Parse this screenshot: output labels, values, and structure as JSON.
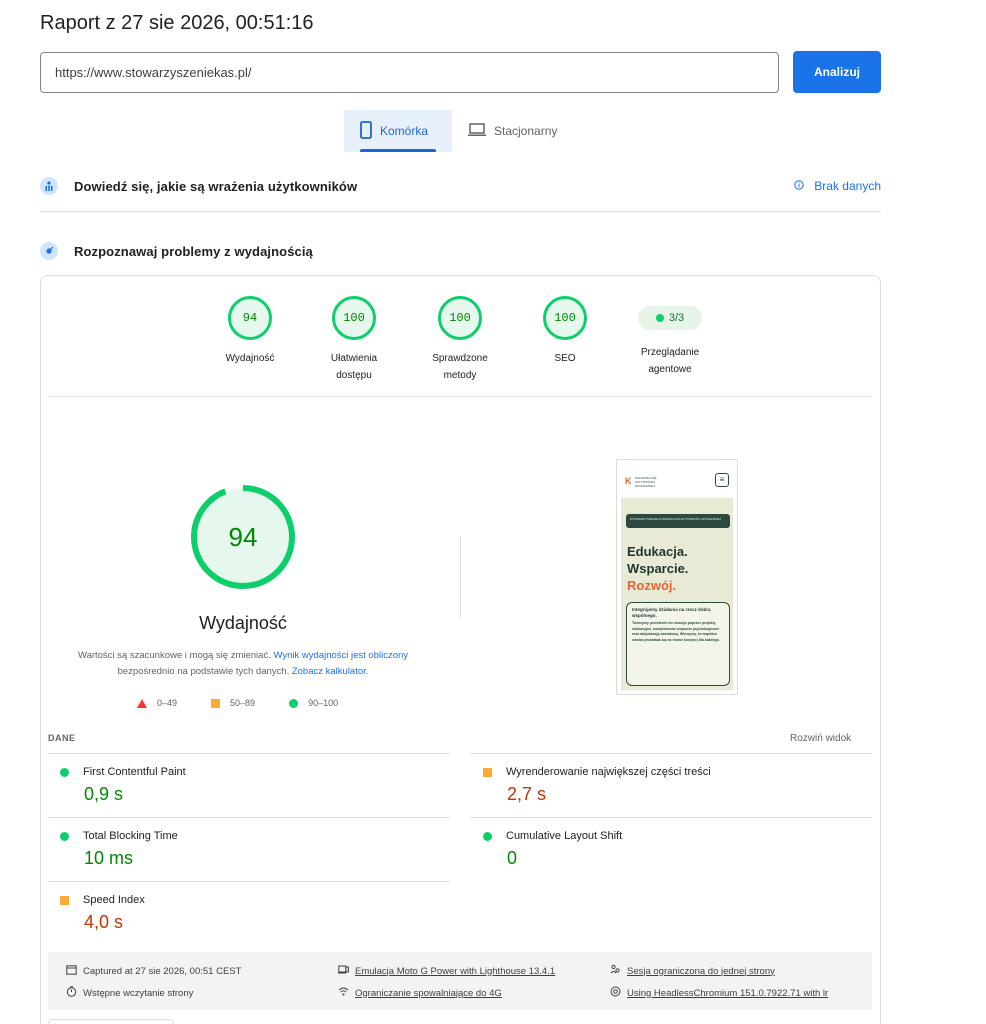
{
  "header": {
    "title": "Raport z 27 sie 2026, 00:51:16",
    "url_value": "https://www.stowarzyszeniekas.pl/",
    "analyze_label": "Analizuj"
  },
  "tabs": [
    {
      "label": "Komórka",
      "icon": "smartphone-icon",
      "selected": true
    },
    {
      "label": "Stacjonarny",
      "icon": "laptop-icon",
      "selected": false
    }
  ],
  "field_section": {
    "title": "Dowiedź się, jakie są wrażenia użytkowników",
    "status": "Brak danych",
    "icon": "users-icon"
  },
  "lab_section": {
    "title": "Rozpoznawaj problemy z wydajnością",
    "icon": "lab-icon"
  },
  "categories": [
    {
      "score": "94",
      "label": "Wydajność"
    },
    {
      "score": "100",
      "label": "Ułatwienia dostępu"
    },
    {
      "score": "100",
      "label": "Sprawdzone metody"
    },
    {
      "score": "100",
      "label": "SEO"
    }
  ],
  "agent": {
    "value": "3/3",
    "label": "Przeglądanie agentowe"
  },
  "performance": {
    "score": "94",
    "score_fraction": 0.94,
    "label": "Wydajność",
    "desc_pre": "Wartości są szacunkowe i mogą się zmieniać. ",
    "desc_link1": "Wynik wydajności jest obliczony",
    "desc_mid": " bezpośrednio na podstawie tych danych. ",
    "desc_link2": "Zobacz kalkulator."
  },
  "legend": [
    {
      "range": "0–49",
      "color": "#ff3333"
    },
    {
      "range": "50–89",
      "color": "#ffaa33"
    },
    {
      "range": "90–100",
      "color": "#0cce6b"
    }
  ],
  "thumbnail": {
    "logo_letter": "K",
    "logo_text": "KONSORCJUM AKTYWNOŚCI SPOŁECZNEJ",
    "banner": "STOWARZYSZENIE KONSORCJUM AKTYWNOŚCI SPOŁECZNEJ",
    "headline1": "Edukacja.",
    "headline2": "Wsparcie.",
    "headline3": "Rozwój.",
    "box_title": "Integrujemy działania na rzecz dobra wspólnego.",
    "box_text": "Tworzymy przestrzeń do rozwoju poprzez projekty edukacyjne, kompleksowe wsparcie psychologiczne oraz aktywizację zawodową. Wierzymy, że wspólna wiedza przekłada się na realne korzyści dla każdego."
  },
  "metrics": {
    "section_label": "DANE",
    "expand_label": "Rozwiń widok",
    "items": [
      {
        "name": "First Contentful Paint",
        "value": "0,9 s",
        "status": "good"
      },
      {
        "name": "Wyrenderowanie największej części treści",
        "value": "2,7 s",
        "status": "average"
      },
      {
        "name": "Total Blocking Time",
        "value": "10 ms",
        "status": "good"
      },
      {
        "name": "Cumulative Layout Shift",
        "value": "0",
        "status": "good"
      },
      {
        "name": "Speed Index",
        "value": "4,0 s",
        "status": "average"
      }
    ]
  },
  "run_info": {
    "captured": "Captured at 27 sie 2026, 00:51 CEST",
    "load": "Wstępne wczytanie strony",
    "emulation": "Emulacja Moto G Power with Lighthouse 13.4.1",
    "throttling": "Ograniczanie spowalniające do 4G",
    "session": "Sesja ograniczona do jednej strony",
    "browser": "Using HeadlessChromium 151.0.7922.71 with lr"
  },
  "colors": {
    "accent": "#1a73e8",
    "good": "#0cce6b",
    "average": "#ffaa33",
    "fail": "#ff3333"
  }
}
